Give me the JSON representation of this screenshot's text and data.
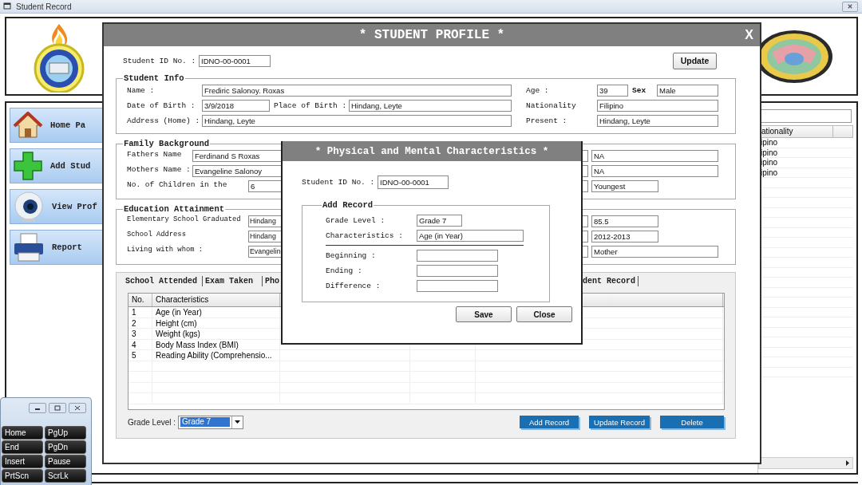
{
  "main_window": {
    "title": "Student Record",
    "nav_buttons": [
      {
        "kind": "home",
        "label": "Home Pa"
      },
      {
        "kind": "add",
        "label": "Add Stud"
      },
      {
        "kind": "view",
        "label": "View Prof"
      },
      {
        "kind": "report",
        "label": "Report"
      }
    ],
    "right_table": {
      "column_1": "ationality",
      "rows": [
        "ipino",
        "ipino",
        "ipino",
        "ipino"
      ]
    }
  },
  "student_profile": {
    "title": "* STUDENT PROFILE *",
    "close": "X",
    "student_id": {
      "label": "Student ID No. :",
      "value": "IDNO-00-0001"
    },
    "update_button": "Update",
    "student_info": {
      "legend": "Student Info",
      "name": {
        "label": "Name :",
        "value": "Frediric Salonoy. Roxas"
      },
      "age": {
        "label": "Age :",
        "value": "39"
      },
      "sex": {
        "label": "Sex",
        "value": "Male"
      },
      "date_of_birth": {
        "label": "Date of Birth :",
        "value": "3/9/2018"
      },
      "place_of_birth": {
        "label": "Place of Birth :",
        "value": "Hindang, Leyte"
      },
      "nationality": {
        "label": "Nationality",
        "value": "Filipino"
      },
      "address_home": {
        "label": "Address (Home) :",
        "value": "Hindang, Leyte"
      },
      "present": {
        "label": "Present :",
        "value": "Hindang, Leyte"
      }
    },
    "family_background": {
      "legend": "Family Background",
      "rows": [
        {
          "label": "Fathers Name",
          "value": "Ferdinand S Roxas",
          "right_value": "NA"
        },
        {
          "label": "Mothers Name :",
          "value": "Evangeline Salonoy",
          "right_value": "NA"
        },
        {
          "label": "No. of Children in the",
          "value": "6",
          "right_value": "Youngest"
        }
      ]
    },
    "education_attainment": {
      "legend": "Education Attainment",
      "rows": [
        {
          "label": "Elementary School Graduated",
          "value": "Hindang",
          "right_value": "85.5"
        },
        {
          "label": "School Address",
          "value": "Hindang",
          "right_value": "2012-2013"
        },
        {
          "label": "Living with whom :",
          "value": "Evangelin",
          "right_value": "Mother"
        }
      ]
    },
    "tabs": [
      "School Attended",
      "Exam Taken",
      "Pho",
      "dent Record"
    ],
    "table": {
      "columns": [
        "No.",
        "Characteristics"
      ],
      "rows": [
        {
          "no": "1",
          "characteristic": "Age (in Year)"
        },
        {
          "no": "2",
          "characteristic": "Height (cm)"
        },
        {
          "no": "3",
          "characteristic": "Weight (kgs)"
        },
        {
          "no": "4",
          "characteristic": "Body Mass Index (BMI)"
        },
        {
          "no": "5",
          "characteristic": "Reading Ability (Comprehensio..."
        }
      ]
    },
    "grade_level": {
      "label": "Grade Level :",
      "value": "Grade 7"
    },
    "buttons": [
      "Add Record",
      "Update Record",
      "Delete"
    ]
  },
  "physical_dialog": {
    "title": "* Physical and Mental Characteristics *",
    "student_id": {
      "label": "Student ID No. :",
      "value": "IDNO-00-0001"
    },
    "legend": "Add Record",
    "fields": [
      {
        "label": "Grade Level :",
        "value": "Grade 7"
      },
      {
        "label": "Characteristics :",
        "value": "Age (in Year)"
      },
      {
        "label": "Beginning :"
      },
      {
        "label": "Ending :"
      },
      {
        "label": "Difference :"
      }
    ],
    "buttons": [
      "Save",
      "Close"
    ]
  },
  "keyboard": {
    "keys": [
      "Home",
      "PgUp",
      "End",
      "PgDn",
      "Insert",
      "Pause",
      "PrtScn",
      "ScrLk"
    ]
  }
}
